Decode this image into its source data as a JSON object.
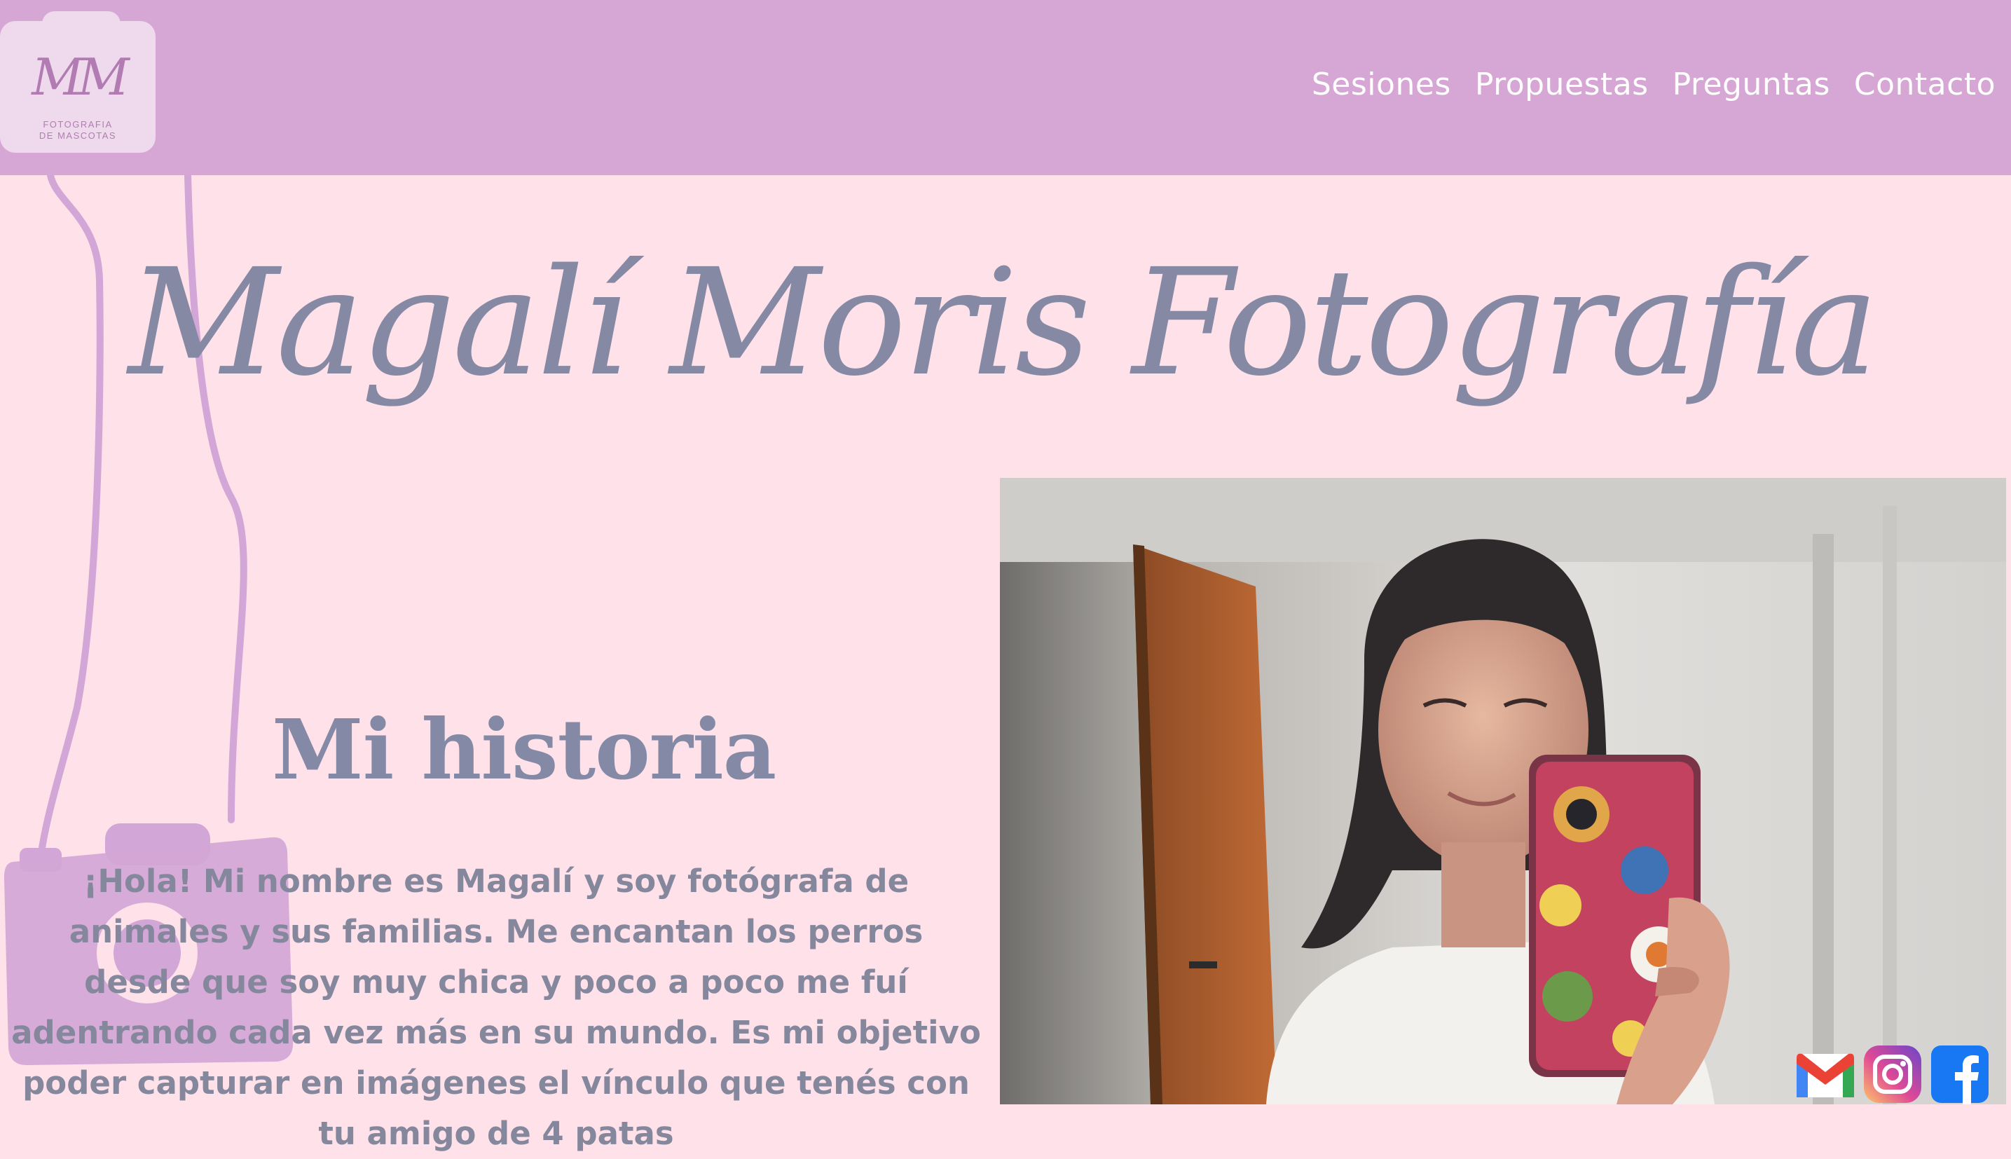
{
  "logo": {
    "mark": "MM",
    "subtitle_line1": "FOTOGRAFIA",
    "subtitle_line2": "DE MASCOTAS"
  },
  "nav": {
    "items": [
      {
        "label": "Sesiones"
      },
      {
        "label": "Propuestas"
      },
      {
        "label": "Preguntas"
      },
      {
        "label": "Contacto"
      }
    ]
  },
  "hero": {
    "title": "Magalí Moris Fotografía"
  },
  "about": {
    "heading": "Mi historia",
    "body": "¡Hola! Mi nombre es Magalí y soy fotógrafa de animales y sus familias. Me encantan los perros desde que soy muy chica y poco a poco me fuí adentrando cada vez más en su mundo. Es mi objetivo poder capturar en imágenes el vínculo que tenés con tu amigo de 4 patas"
  },
  "social": {
    "icons": [
      "gmail-icon",
      "instagram-icon",
      "facebook-icon"
    ]
  },
  "colors": {
    "header_bg": "#d6a7d4",
    "page_bg": "#ffe1ea",
    "text_slate": "#8589a3",
    "lilac_accent": "#d2a6d6"
  }
}
